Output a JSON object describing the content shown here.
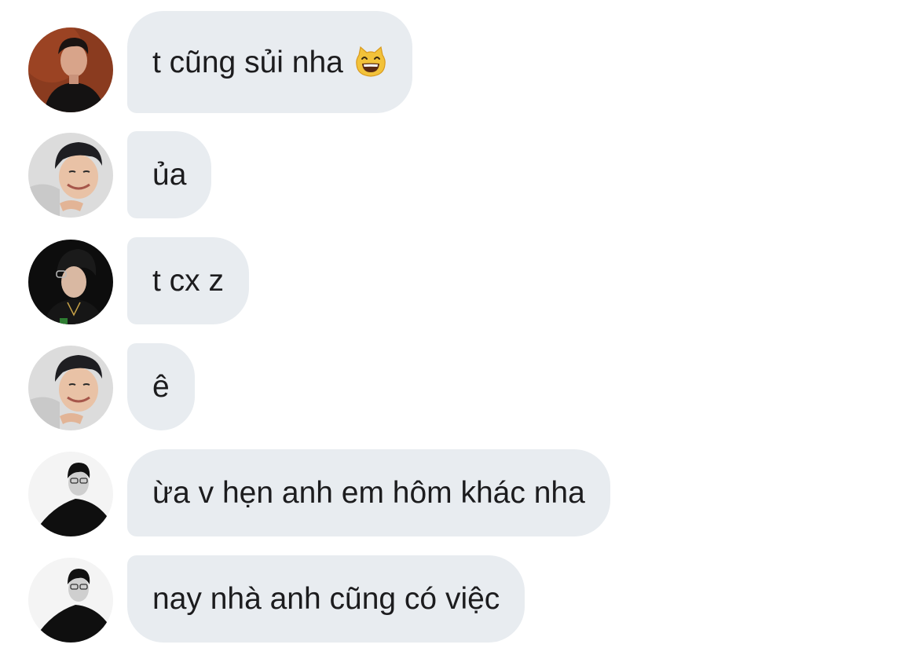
{
  "messages": [
    {
      "text": "t cũng sủi nha",
      "emoji": "grinning-cat-emoji",
      "avatar": "avatar-warm-portrait"
    },
    {
      "text": "ủa",
      "avatar": "avatar-smiling-boy"
    },
    {
      "text": "t cx z",
      "avatar": "avatar-glasses-boy"
    },
    {
      "text": "ê",
      "avatar": "avatar-smiling-boy"
    },
    {
      "text": "ừa v hẹn anh em hôm khác nha",
      "avatar": "avatar-suit-man"
    },
    {
      "text": "nay nhà anh cũng có việc",
      "avatar": "avatar-suit-man"
    }
  ],
  "colors": {
    "background": "#ffffff",
    "bubble": "#e8ecf0",
    "text": "#1c1c1e"
  }
}
